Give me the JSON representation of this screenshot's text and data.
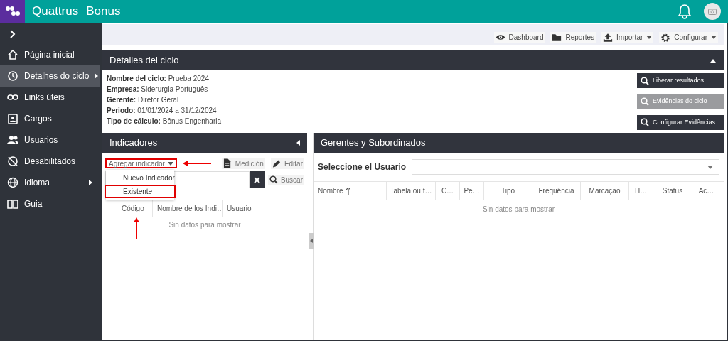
{
  "header": {
    "app_name": "Quattrus",
    "product": "Bonus"
  },
  "sidebar": {
    "items": [
      {
        "label": "Página inicial",
        "selected": false,
        "submenu": false
      },
      {
        "label": "Detalhes do ciclo",
        "selected": true,
        "submenu": true
      },
      {
        "label": "Links úteis",
        "selected": false,
        "submenu": false
      },
      {
        "label": "Cargos",
        "selected": false,
        "submenu": false
      },
      {
        "label": "Usuarios",
        "selected": false,
        "submenu": false
      },
      {
        "label": "Desabilitados",
        "selected": false,
        "submenu": false
      },
      {
        "label": "Idioma",
        "selected": false,
        "submenu": true
      },
      {
        "label": "Guia",
        "selected": false,
        "submenu": false
      }
    ]
  },
  "toolbar": [
    {
      "label": "Dashboard",
      "dropdown": false
    },
    {
      "label": "Reportes",
      "dropdown": false
    },
    {
      "label": "Importar",
      "dropdown": true
    },
    {
      "label": "Configurar",
      "dropdown": true
    }
  ],
  "cycle": {
    "title": "Detalles del ciclo",
    "fields": [
      {
        "label": "Nombre del ciclo:",
        "value": "Prueba 2024"
      },
      {
        "label": "Empresa:",
        "value": "Siderurgia Português"
      },
      {
        "label": "Gerente:",
        "value": "Diretor Geral"
      },
      {
        "label": "Periodo:",
        "value": "01/01/2024 a 31/12/2024"
      },
      {
        "label": "Tipo de cálculo:",
        "value": "Bônus Engenharia"
      }
    ],
    "actions": [
      {
        "label": "Liberar resultados",
        "disabled": false
      },
      {
        "label": "Evidências do ciclo",
        "disabled": true
      },
      {
        "label": "Configurar Evidências",
        "disabled": false
      }
    ]
  },
  "indicators": {
    "title": "Indicadores",
    "add_button": "Agregar indicador",
    "menu": [
      {
        "label": "Nuevo Indicador"
      },
      {
        "label": "Existente"
      }
    ],
    "actions": [
      "Medición",
      "Editar"
    ],
    "search_button": "Buscar",
    "columns": [
      "Código",
      "Nombre de los Indi…",
      "Usuario"
    ],
    "empty": "Sin datos para mostrar"
  },
  "users": {
    "title": "Gerentes y Subordinados",
    "select_label": "Seleccione el Usuario",
    "columns": [
      {
        "label": "Nombre",
        "sorted": true
      },
      {
        "label": "Tabela ou f…",
        "sorted": false
      },
      {
        "label": "C…",
        "sorted": false
      },
      {
        "label": "Pe…",
        "sorted": false
      },
      {
        "label": "Tipo",
        "sorted": false
      },
      {
        "label": "Frequência",
        "sorted": false
      },
      {
        "label": "Marcação",
        "sorted": false
      },
      {
        "label": "H…",
        "sorted": false
      },
      {
        "label": "Status",
        "sorted": false
      },
      {
        "label": "Ac…",
        "sorted": false
      }
    ],
    "empty": "Sin datos para mostrar"
  }
}
